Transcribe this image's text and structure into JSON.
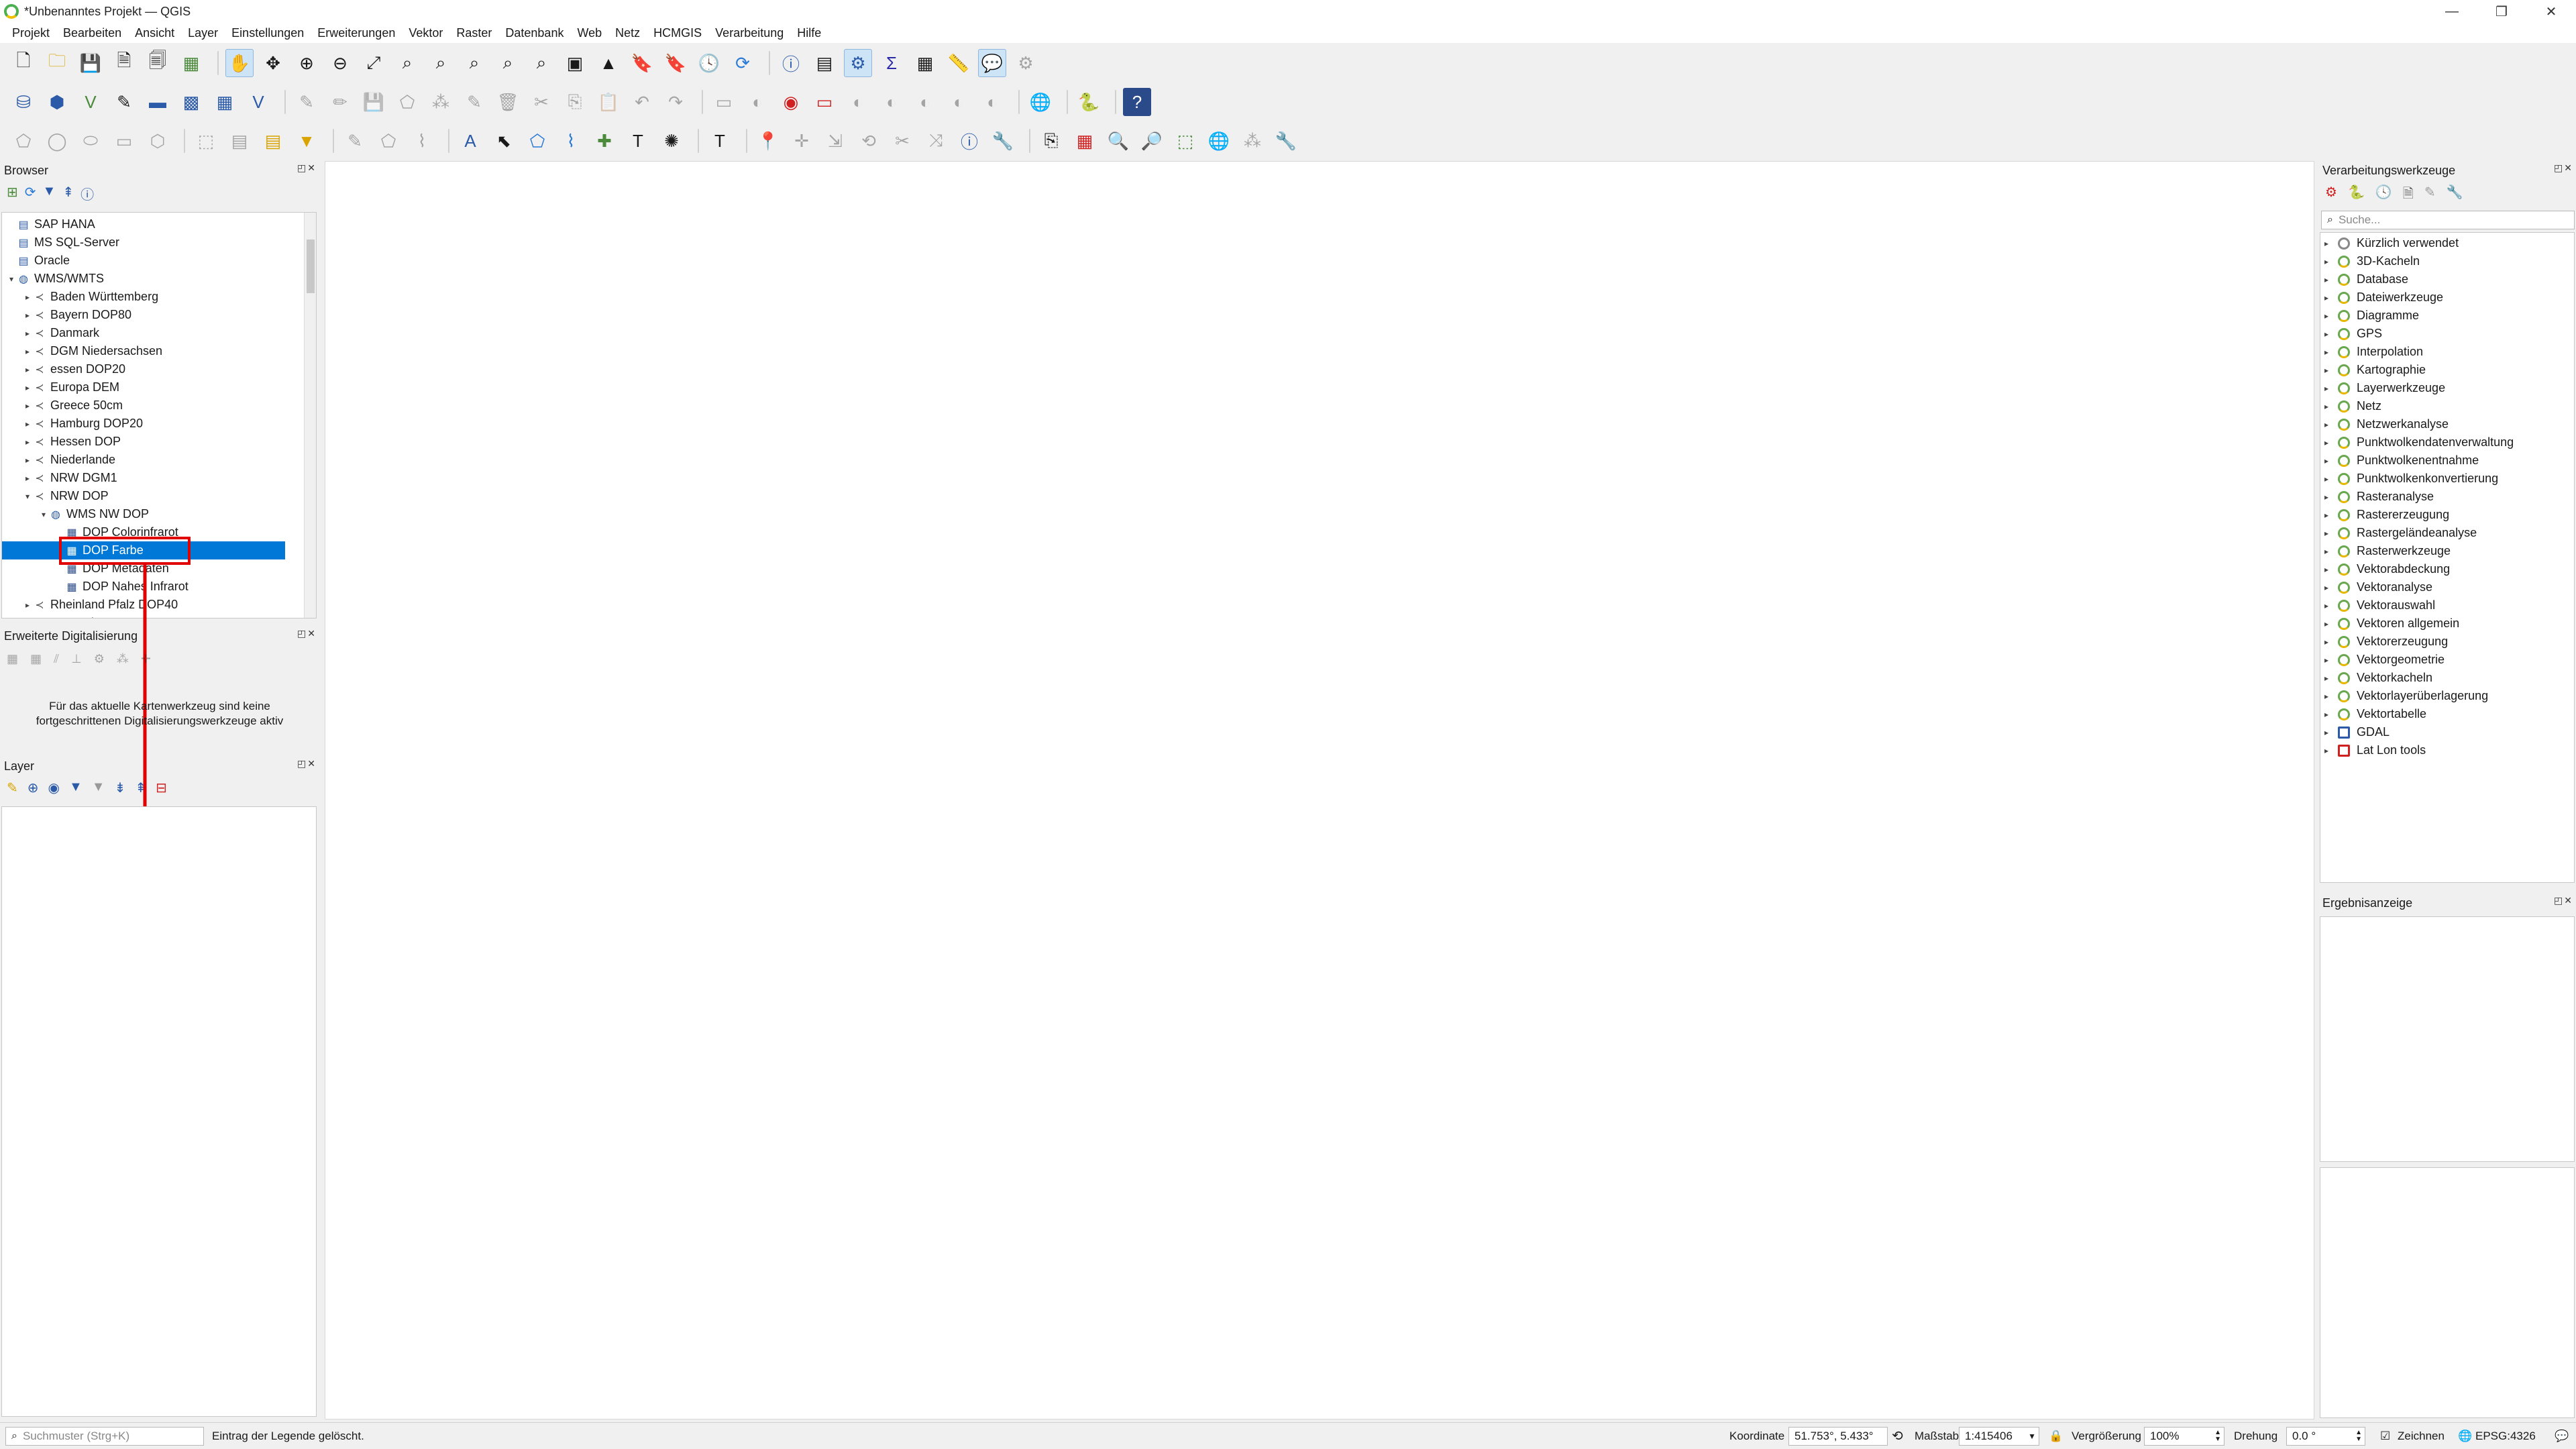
{
  "window": {
    "title": "*Unbenanntes Projekt — QGIS"
  },
  "menu": [
    "Projekt",
    "Bearbeiten",
    "Ansicht",
    "Layer",
    "Einstellungen",
    "Erweiterungen",
    "Vektor",
    "Raster",
    "Datenbank",
    "Web",
    "Netz",
    "HCMGIS",
    "Verarbeitung",
    "Hilfe"
  ],
  "browser": {
    "title": "Browser",
    "items": [
      {
        "label": "SAP HANA",
        "icon": "database-icon",
        "level": 0,
        "arrow": ""
      },
      {
        "label": "MS SQL-Server",
        "icon": "database-icon",
        "level": 0,
        "arrow": ""
      },
      {
        "label": "Oracle",
        "icon": "database-icon",
        "level": 0,
        "arrow": ""
      },
      {
        "label": "WMS/WMTS",
        "icon": "globe-icon",
        "level": 0,
        "arrow": "▾"
      },
      {
        "label": "Baden Württemberg",
        "icon": "connection-icon",
        "level": 1,
        "arrow": "▸"
      },
      {
        "label": "Bayern DOP80",
        "icon": "connection-icon",
        "level": 1,
        "arrow": "▸"
      },
      {
        "label": "Danmark",
        "icon": "connection-icon",
        "level": 1,
        "arrow": "▸"
      },
      {
        "label": "DGM Niedersachsen",
        "icon": "connection-icon",
        "level": 1,
        "arrow": "▸"
      },
      {
        "label": "essen DOP20",
        "icon": "connection-icon",
        "level": 1,
        "arrow": "▸"
      },
      {
        "label": "Europa DEM",
        "icon": "connection-icon",
        "level": 1,
        "arrow": "▸"
      },
      {
        "label": "Greece 50cm",
        "icon": "connection-icon",
        "level": 1,
        "arrow": "▸"
      },
      {
        "label": "Hamburg DOP20",
        "icon": "connection-icon",
        "level": 1,
        "arrow": "▸"
      },
      {
        "label": "Hessen DOP",
        "icon": "connection-icon",
        "level": 1,
        "arrow": "▸"
      },
      {
        "label": "Niederlande",
        "icon": "connection-icon",
        "level": 1,
        "arrow": "▸"
      },
      {
        "label": "NRW DGM1",
        "icon": "connection-icon",
        "level": 1,
        "arrow": "▸"
      },
      {
        "label": "NRW DOP",
        "icon": "connection-icon",
        "level": 1,
        "arrow": "▾"
      },
      {
        "label": "WMS NW DOP",
        "icon": "globe-icon",
        "level": 2,
        "arrow": "▾"
      },
      {
        "label": "DOP Colorinfrarot",
        "icon": "raster-layer-icon",
        "level": 3,
        "arrow": ""
      },
      {
        "label": "DOP Farbe",
        "icon": "raster-layer-icon",
        "level": 3,
        "arrow": "",
        "selected": true
      },
      {
        "label": "DOP Metadaten",
        "icon": "raster-layer-icon",
        "level": 3,
        "arrow": ""
      },
      {
        "label": "DOP Nahes Infrarot",
        "icon": "raster-layer-icon",
        "level": 3,
        "arrow": ""
      },
      {
        "label": "Rheinland Pfalz DOP40",
        "icon": "connection-icon",
        "level": 1,
        "arrow": "▸"
      },
      {
        "label": "RLP Schummerung 10m",
        "icon": "connection-icon",
        "level": 1,
        "arrow": "▸"
      }
    ]
  },
  "digitizing": {
    "title": "Erweiterte Digitalisierung",
    "message": "Für das aktuelle Kartenwerkzeug sind keine fortgeschrittenen Digitalisierungswerkzeuge aktiv"
  },
  "layers": {
    "title": "Layer"
  },
  "processing": {
    "title": "Verarbeitungswerkzeuge",
    "search_placeholder": "Suche...",
    "items": [
      "Kürzlich verwendet",
      "3D-Kacheln",
      "Database",
      "Dateiwerkzeuge",
      "Diagramme",
      "GPS",
      "Interpolation",
      "Kartographie",
      "Layerwerkzeuge",
      "Netz",
      "Netzwerkanalyse",
      "Punktwolkendatenverwaltung",
      "Punktwolkenentnahme",
      "Punktwolkenkonvertierung",
      "Rasteranalyse",
      "Rastererzeugung",
      "Rastergeländeanalyse",
      "Rasterwerkzeuge",
      "Vektorabdeckung",
      "Vektoranalyse",
      "Vektorauswahl",
      "Vektoren allgemein",
      "Vektorerzeugung",
      "Vektorgeometrie",
      "Vektorkacheln",
      "Vektorlayerüberlagerung",
      "Vektortabelle",
      "GDAL",
      "Lat Lon tools"
    ]
  },
  "results": {
    "title": "Ergebnisanzeige"
  },
  "status": {
    "search_placeholder": "Suchmuster (Strg+K)",
    "message": "Eintrag der Legende gelöscht.",
    "coord_label": "Koordinate",
    "coord_value": "51.753°, 5.433°",
    "scale_label": "Maßstab",
    "scale_value": "1:415406",
    "magnifier_label": "Vergrößerung",
    "magnifier_value": "100%",
    "rotation_label": "Drehung",
    "rotation_value": "0.0 °",
    "render_label": "Zeichnen",
    "crs": "EPSG:4326"
  },
  "colors": {
    "selection": "#0078d7",
    "annotation": "#e00000"
  }
}
